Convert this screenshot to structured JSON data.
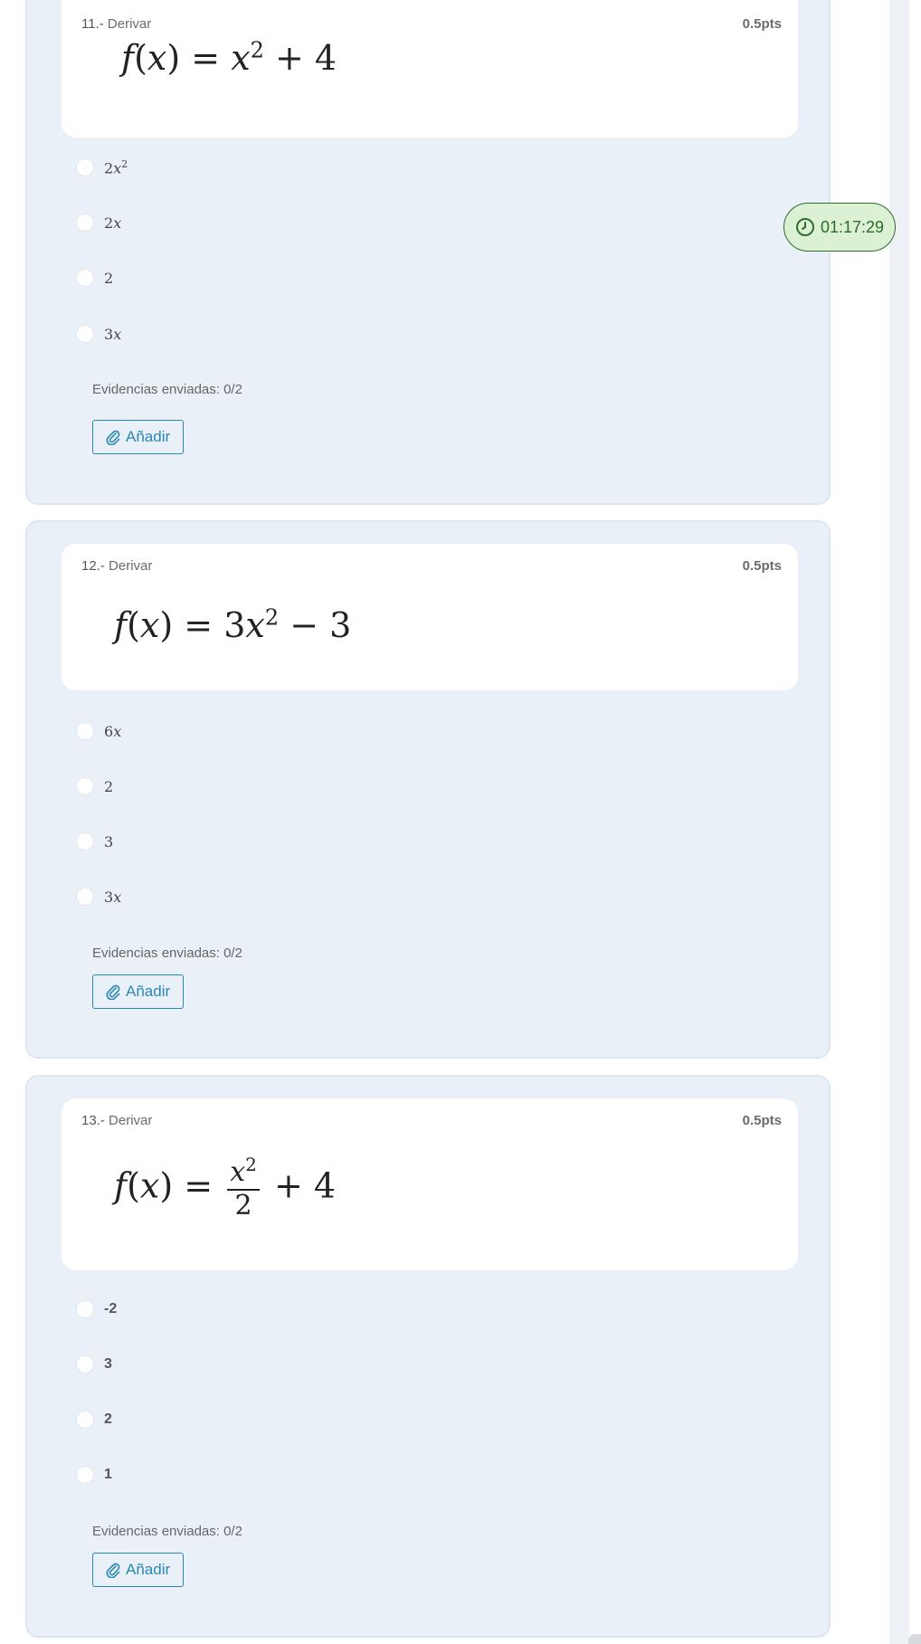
{
  "timer": {
    "value": "01:17:29",
    "icon": "clock-icon"
  },
  "questions": [
    {
      "number": "11.-",
      "label": "Derivar",
      "points": "0.5pts",
      "options": [
        {
          "base": "2",
          "var": "x",
          "sup": "2"
        },
        {
          "base": "2",
          "var": "x",
          "sup": ""
        },
        {
          "base": "2",
          "var": "",
          "sup": ""
        },
        {
          "base": "3",
          "var": "x",
          "sup": ""
        }
      ],
      "evidence": "Evidencias enviadas: 0/2",
      "add_label": "Añadir"
    },
    {
      "number": "12.-",
      "label": "Derivar",
      "points": "0.5pts",
      "options": [
        {
          "base": "6",
          "var": "x",
          "sup": ""
        },
        {
          "base": "2",
          "var": "",
          "sup": ""
        },
        {
          "base": "3",
          "var": "",
          "sup": ""
        },
        {
          "base": "3",
          "var": "x",
          "sup": ""
        }
      ],
      "evidence": "Evidencias enviadas: 0/2",
      "add_label": "Añadir"
    },
    {
      "number": "13.-",
      "label": "Derivar",
      "points": "0.5pts",
      "options": [
        {
          "base": "-2",
          "var": "",
          "sup": ""
        },
        {
          "base": "3",
          "var": "",
          "sup": ""
        },
        {
          "base": "2",
          "var": "",
          "sup": ""
        },
        {
          "base": "1",
          "var": "",
          "sup": ""
        }
      ],
      "evidence": "Evidencias enviadas: 0/2",
      "add_label": "Añadir"
    }
  ],
  "formulas": {
    "f": "f",
    "x": "x",
    "open": "(",
    "close": ")",
    "eq": "=",
    "q11": {
      "base": "x",
      "exp": "2",
      "rest": "+ 4"
    },
    "q12": {
      "coef": "3",
      "base": "x",
      "exp": "2",
      "rest": "− 3"
    },
    "q13": {
      "num_base": "x",
      "num_exp": "2",
      "den": "2",
      "rest": "+ 4"
    }
  },
  "colors": {
    "card_bg": "#eaf0f7",
    "accent": "#2a88b0",
    "timer_bg": "#dcf1d4",
    "timer_fg": "#2e6b2c"
  }
}
